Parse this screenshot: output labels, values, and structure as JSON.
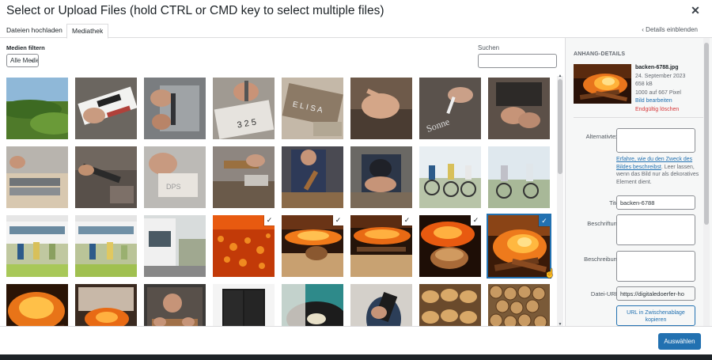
{
  "modal": {
    "title": "Select or Upload Files (hold CTRL or CMD key to select multiple files)",
    "close_icon": "close-icon"
  },
  "tabs": [
    {
      "label": "Dateien hochladen",
      "active": false
    },
    {
      "label": "Mediathek",
      "active": true
    }
  ],
  "details_toggle": "‹ Details einblenden",
  "filter": {
    "label": "Medien filtern",
    "selected": "Alle Medien"
  },
  "search": {
    "label": "Suchen",
    "value": ""
  },
  "grid": {
    "thumbnails": [
      {
        "id": "landscape-hills",
        "checked": false
      },
      {
        "id": "sign-painting",
        "checked": false
      },
      {
        "id": "metal-cutting",
        "checked": false
      },
      {
        "id": "stamping-letters",
        "checked": false
      },
      {
        "id": "house-sign",
        "checked": false
      },
      {
        "id": "hand-lettering",
        "checked": false
      },
      {
        "id": "chalk-lettering",
        "checked": false
      },
      {
        "id": "craftsman-hands",
        "checked": false
      },
      {
        "id": "plane-tool",
        "checked": false
      },
      {
        "id": "drill-bit",
        "checked": false
      },
      {
        "id": "sanding-block",
        "checked": false
      },
      {
        "id": "chisel-wood",
        "checked": false
      },
      {
        "id": "woodcarver",
        "checked": false
      },
      {
        "id": "workshop-man",
        "checked": false
      },
      {
        "id": "cyclists-1",
        "checked": false
      },
      {
        "id": "cyclists-2",
        "checked": false
      },
      {
        "id": "train-cyclists-1",
        "checked": false
      },
      {
        "id": "train-cyclists-2",
        "checked": false
      },
      {
        "id": "tram-station",
        "checked": false
      },
      {
        "id": "embers",
        "checked": true
      },
      {
        "id": "bread-oven-1",
        "checked": true
      },
      {
        "id": "bread-oven-2",
        "checked": true
      },
      {
        "id": "bread-oven-3",
        "checked": true
      },
      {
        "id": "backen-6788",
        "checked": true,
        "selected": true
      },
      {
        "id": "fire-wood",
        "checked": false
      },
      {
        "id": "fire-oven",
        "checked": false
      },
      {
        "id": "woodworking",
        "checked": false
      },
      {
        "id": "speakers",
        "checked": false
      },
      {
        "id": "vinyl-record",
        "checked": false
      },
      {
        "id": "phone-hand",
        "checked": false
      },
      {
        "id": "bakery-bread",
        "checked": false
      },
      {
        "id": "firewood-stack",
        "checked": false
      }
    ]
  },
  "details": {
    "heading": "ANHANG-DETAILS",
    "filename": "backen-6788.jpg",
    "date": "24. September 2023",
    "filesize": "658 kB",
    "dimensions": "1000 auf 667 Pixel",
    "edit_link": "Bild bearbeiten",
    "delete_link": "Endgültig löschen",
    "alt_label": "Alternativtext",
    "alt_value": "",
    "alt_help_link": "Erfahre, wie du den Zweck des Bildes beschreibst",
    "alt_help_rest": ". Leer lassen, wenn das Bild nur als dekoratives Element dient.",
    "title_label": "Titel",
    "title_value": "backen-6788",
    "caption_label": "Beschriftung",
    "caption_value": "",
    "description_label": "Beschreibung",
    "description_value": "",
    "url_label": "Datei-URL:",
    "url_value": "https://digitaledoerfer-ho",
    "copy_button": "URL in Zwischenablage kopieren"
  },
  "footer": {
    "select_button": "Auswählen"
  },
  "colors": {
    "accent": "#2271b1",
    "danger": "#d63638"
  }
}
